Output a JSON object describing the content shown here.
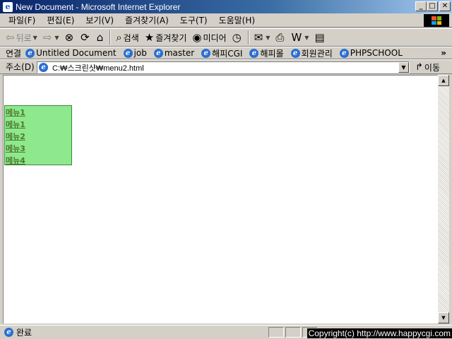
{
  "window": {
    "title": "New Document - Microsoft Internet Explorer",
    "controls": {
      "minimize": "_",
      "maximize": "□",
      "close": "✕"
    }
  },
  "menubar": {
    "items": [
      {
        "label": "파일(F)"
      },
      {
        "label": "편집(E)"
      },
      {
        "label": "보기(V)"
      },
      {
        "label": "즐겨찾기(A)"
      },
      {
        "label": "도구(T)"
      },
      {
        "label": "도움말(H)"
      }
    ]
  },
  "toolbar": {
    "back_label": "뒤로",
    "search_label": "검색",
    "favorites_label": "즐겨찾기",
    "media_label": "미디어"
  },
  "links": {
    "label": "연결",
    "items": [
      {
        "label": "Untitled Document"
      },
      {
        "label": "job"
      },
      {
        "label": "master"
      },
      {
        "label": "해피CGI"
      },
      {
        "label": "해피몰"
      },
      {
        "label": "회원관리"
      },
      {
        "label": "PHPSCHOOL"
      }
    ],
    "more": "»"
  },
  "address": {
    "label": "주소(D)",
    "value": "C:₩스크린샷₩menu2.html",
    "go_label": "이동"
  },
  "page": {
    "menu_items": [
      {
        "label": "메뉴1"
      },
      {
        "label": "메뉴1"
      },
      {
        "label": "메뉴2"
      },
      {
        "label": "메뉴3"
      },
      {
        "label": "메뉴4"
      }
    ],
    "menu_bg": "#8ee88e",
    "menu_text_color": "#4b7a2a"
  },
  "status": {
    "text": "완료",
    "copyright": "Copyright(c) http://www.happycgi.com"
  }
}
